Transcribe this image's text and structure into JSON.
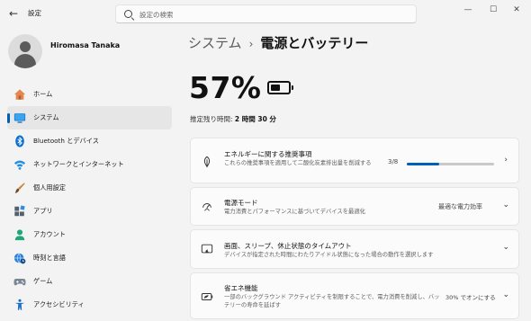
{
  "window": {
    "title": "設定",
    "back_icon": "arrow-left-icon",
    "controls": [
      "minimize-icon",
      "maximize-icon",
      "close-icon"
    ]
  },
  "search": {
    "placeholder": "設定の検索",
    "icon": "search-icon"
  },
  "profile": {
    "name": "Hiromasa Tanaka"
  },
  "sidebar": {
    "items": [
      {
        "label": "ホーム",
        "icon": "home-icon"
      },
      {
        "label": "システム",
        "icon": "monitor-icon",
        "active": true
      },
      {
        "label": "Bluetooth とデバイス",
        "icon": "bluetooth-icon"
      },
      {
        "label": "ネットワークとインターネット",
        "icon": "wifi-icon"
      },
      {
        "label": "個人用設定",
        "icon": "brush-icon"
      },
      {
        "label": "アプリ",
        "icon": "apps-icon"
      },
      {
        "label": "アカウント",
        "icon": "account-icon"
      },
      {
        "label": "時刻と言語",
        "icon": "globe-clock-icon"
      },
      {
        "label": "ゲーム",
        "icon": "gamepad-icon"
      },
      {
        "label": "アクセシビリティ",
        "icon": "accessibility-icon"
      }
    ]
  },
  "breadcrumb": {
    "parent": "システム",
    "separator": "›",
    "current": "電源とバッテリー"
  },
  "battery": {
    "percent_label": "57%",
    "level": 0.57,
    "remaining_label": "推定残り時間:",
    "remaining_value": "2 時間 30 分"
  },
  "cards": {
    "energy": {
      "title": "エネルギーに関する推奨事項",
      "desc": "これらの推奨事項を適用して二酸化炭素排出量を削減する",
      "value": "3/8",
      "progress": 0.375,
      "icon": "leaf-icon"
    },
    "power_mode": {
      "title": "電源モード",
      "desc": "電力消費とパフォーマンスに基づいてデバイスを最適化",
      "value": "最適な電力効率",
      "icon": "power-mode-icon"
    },
    "screen_sleep": {
      "title": "画面、スリープ、休止状態のタイムアウト",
      "desc": "デバイスが指定された時間にわたりアイドル状態になった場合の動作を選択します",
      "icon": "screen-sleep-icon"
    },
    "battery_saver": {
      "title": "省エネ機能",
      "desc": "一部のバックグラウンド アクティビティを制限することで、電力消費を削減し、バッテリーの寿命を延ばす",
      "value": "30% でオンにする",
      "icon": "battery-saver-icon"
    }
  },
  "colors": {
    "accent": "#005fb8",
    "background": "#f3f3f3",
    "card": "#fbfbfb"
  }
}
